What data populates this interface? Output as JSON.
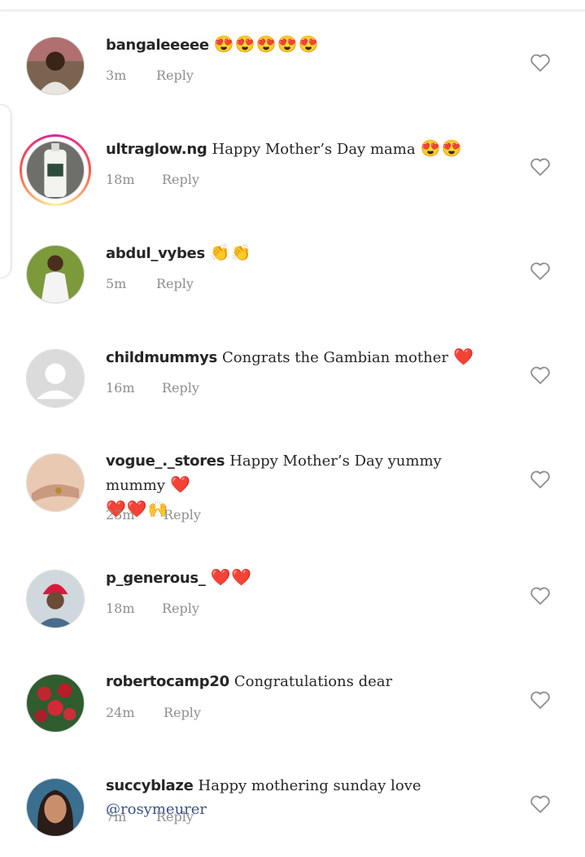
{
  "comments": [
    {
      "username": "bangaleeeee",
      "text": "",
      "emoji": "😍😍😍😍😍",
      "emoji2": "",
      "mention": "",
      "time": "3m",
      "reply_label": "Reply"
    },
    {
      "username": "ultraglow.ng",
      "text": "Happy Mother’s Day mama",
      "emoji": "😍😍",
      "emoji2": "",
      "mention": "",
      "time": "18m",
      "reply_label": "Reply"
    },
    {
      "username": "abdul_vybes",
      "text": "",
      "emoji": "👏👏",
      "emoji2": "",
      "mention": "",
      "time": "5m",
      "reply_label": "Reply"
    },
    {
      "username": "childmummys",
      "text": "Congrats the Gambian mother",
      "emoji": "❤️",
      "emoji2": "",
      "mention": "",
      "time": "16m",
      "reply_label": "Reply"
    },
    {
      "username": "vogue_._stores",
      "text": "Happy Mother’s Day yummy mummy",
      "emoji": "❤️",
      "emoji2": "❤️❤️🙌",
      "mention": "",
      "time": "23m",
      "reply_label": "Reply"
    },
    {
      "username": "p_generous_",
      "text": "",
      "emoji": "❤️❤️",
      "emoji2": "",
      "mention": "",
      "time": "18m",
      "reply_label": "Reply"
    },
    {
      "username": "robertocamp20",
      "text": "Congratulations dear",
      "emoji": "",
      "emoji2": "",
      "mention": "",
      "time": "24m",
      "reply_label": "Reply"
    },
    {
      "username": "succyblaze",
      "text": "Happy mothering sunday love",
      "emoji": "",
      "emoji2": "",
      "mention": "@rosymeurer",
      "time": "7m",
      "reply_label": "Reply"
    }
  ],
  "colors": {
    "meta": "#8e8e8e",
    "mention": "#385185",
    "text": "#262626"
  },
  "icons": {
    "like": "heart-outline-icon"
  }
}
